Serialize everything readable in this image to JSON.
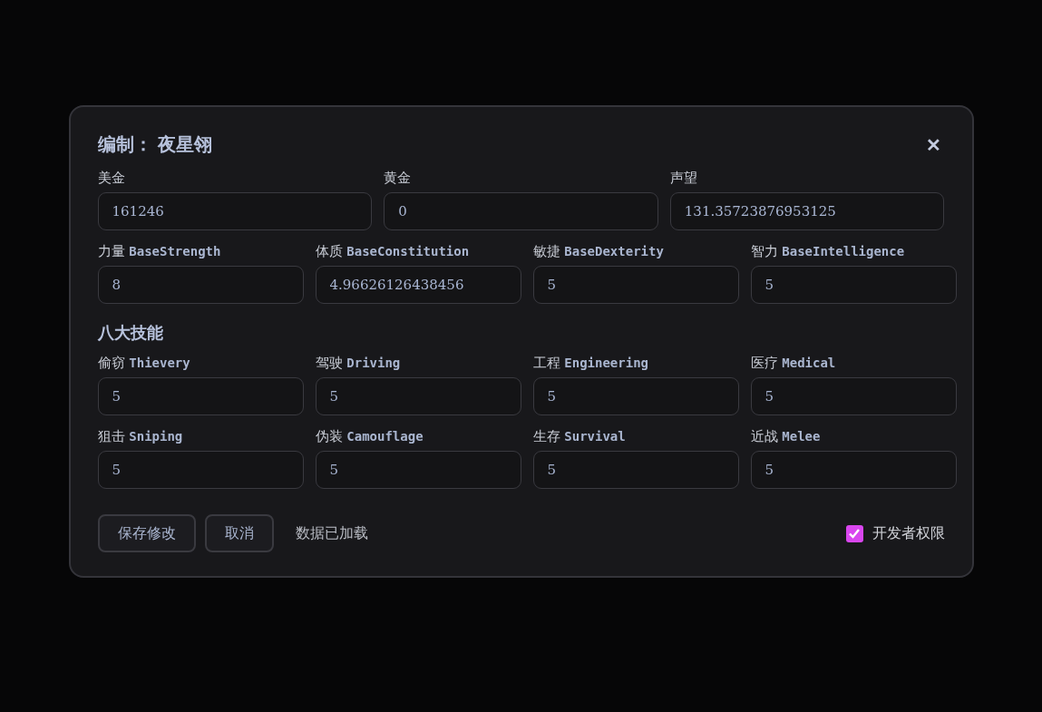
{
  "dialog": {
    "title": "编制： 夜星翎",
    "close": "✕",
    "money_fields": [
      {
        "label": "美金",
        "value": "161246"
      },
      {
        "label": "黄金",
        "value": "0"
      },
      {
        "label": "声望",
        "value": "131.35723876953125"
      }
    ],
    "base_fields": [
      {
        "label": "力量 **BaseStrength**",
        "value": "8"
      },
      {
        "label": "体质 **BaseConstitution**",
        "value": "4.96626126438456"
      },
      {
        "label": "敏捷 **BaseDexterity**",
        "value": "5"
      },
      {
        "label": "智力 **BaseIntelligence**",
        "value": "5"
      }
    ],
    "skills_heading": "八大技能",
    "skill_fields": [
      {
        "label": "偷窃 **Thievery**",
        "value": "5"
      },
      {
        "label": "驾驶 **Driving**",
        "value": "5"
      },
      {
        "label": "工程 **Engineering**",
        "value": "5"
      },
      {
        "label": "医疗 **Medical**",
        "value": "5"
      },
      {
        "label": "狙击 **Sniping**",
        "value": "5"
      },
      {
        "label": "伪装 **Camouflage**",
        "value": "5"
      },
      {
        "label": "生存 **Survival**",
        "value": "5"
      },
      {
        "label": "近战 **Melee**",
        "value": "5"
      }
    ],
    "buttons": [
      "保存修改",
      "取消"
    ],
    "status": "数据已加载",
    "developer_mode": {
      "label": "开发者权限",
      "checked": true
    }
  }
}
